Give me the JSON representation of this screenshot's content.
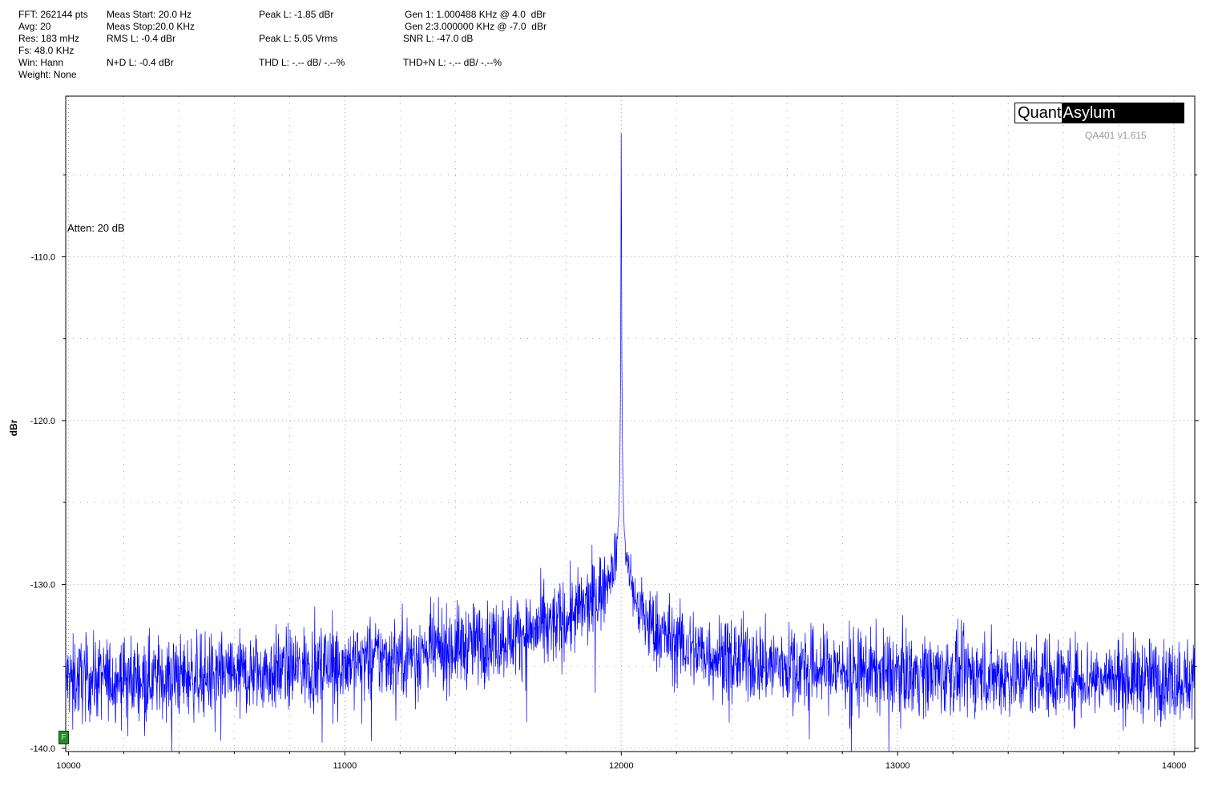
{
  "info": {
    "fft": "FFT: 262144 pts",
    "avg": "Avg: 20",
    "res": "Res: 183 mHz",
    "fs": "Fs: 48.0 KHz",
    "win": "Win: Hann",
    "weight": "Weight: None",
    "meas_start": "Meas Start: 20.0 Hz",
    "meas_stop": "Meas Stop:20.0 KHz",
    "rms_l": "RMS L: -0.4 dBr",
    "nd_l": "N+D L: -0.4 dBr",
    "peak_l_dbr": "Peak L: -1.85 dBr",
    "peak_l_vrms": "Peak L: 5.05 Vrms",
    "thd_l": "THD L: -.-- dB/ -.--%",
    "gen1": "Gen 1: 1.000488 KHz @ 4.0  dBr",
    "gen2": "Gen 2:3.000000 KHz @ -7.0  dBr",
    "snr_l": "SNR L: -47.0 dB",
    "thdn_l": "THD+N L: -.-- dB/ -.--%"
  },
  "logo": {
    "left": "Quant",
    "right": "Asylum"
  },
  "version": "QA401 v1.615",
  "atten": "Atten: 20 dB",
  "marker_label": "F",
  "colors": {
    "trace": "#0000ff",
    "grid": "#a0a0a0",
    "marker": "#2a8a2a"
  },
  "chart_data": {
    "type": "line",
    "title": "",
    "xlabel": "",
    "ylabel": "dBr",
    "xlim": [
      9990,
      14075
    ],
    "ylim": [
      -140.2,
      -100.2
    ],
    "x_ticks": [
      10000,
      11000,
      12000,
      13000,
      14000
    ],
    "y_ticks": [
      -110.0,
      -120.0,
      -130.0,
      -140.0
    ],
    "x_tick_labels": [
      "10000",
      "11000",
      "12000",
      "13000",
      "14000"
    ],
    "y_tick_labels": [
      "-110.0",
      "-120.0",
      "-130.0",
      "-140.0"
    ],
    "grid": true,
    "series": [
      {
        "color": "#0000ff",
        "x": [
          10000,
          10250,
          10500,
          10750,
          11000,
          11250,
          11500,
          11700,
          11800,
          11900,
          11950,
          11980,
          11990,
          11995,
          11998,
          12000,
          12002,
          12005,
          12010,
          12020,
          12050,
          12100,
          12200,
          12300,
          12500,
          12750,
          13000,
          13250,
          13500,
          13750,
          14000,
          14075
        ],
        "y": [
          -135.8,
          -135.7,
          -135.6,
          -135.3,
          -134.7,
          -134.3,
          -133.5,
          -132.8,
          -132.2,
          -131.0,
          -129.8,
          -128.3,
          -126.5,
          -123.0,
          -116.0,
          -100.2,
          -116.0,
          -123.0,
          -126.5,
          -128.5,
          -131.0,
          -132.5,
          -133.6,
          -134.2,
          -134.8,
          -135.2,
          -135.4,
          -135.5,
          -135.6,
          -135.7,
          -135.8,
          -135.8
        ]
      }
    ]
  }
}
